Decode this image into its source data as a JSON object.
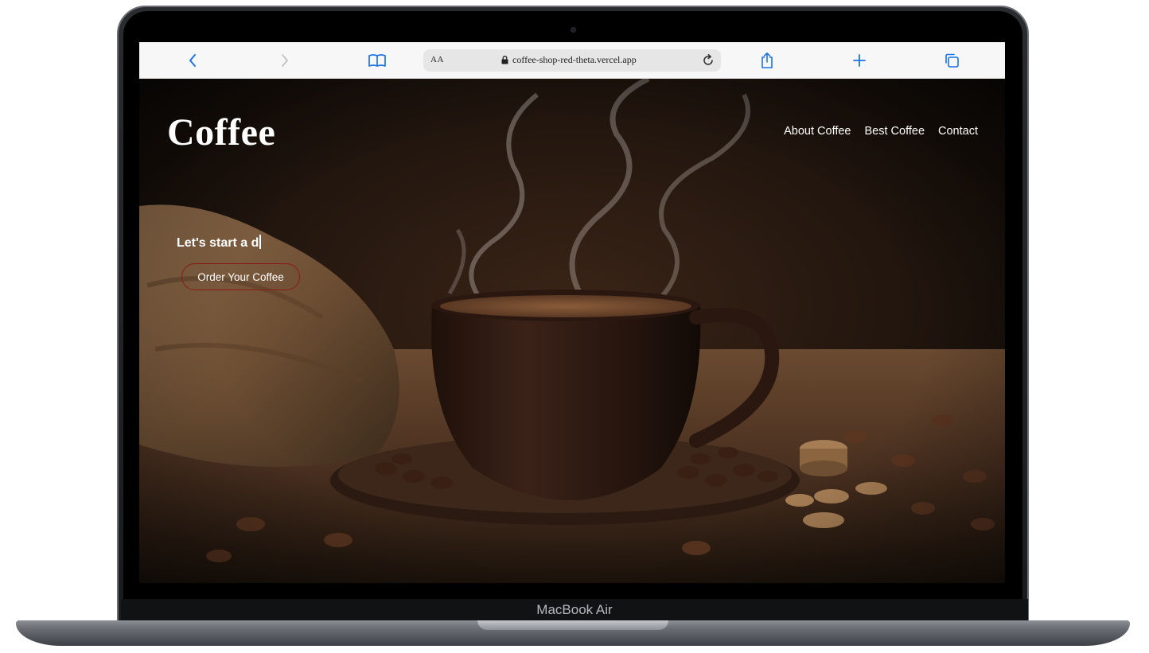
{
  "device": {
    "model_label": "MacBook Air"
  },
  "browser": {
    "address": {
      "text_size_label": "AA",
      "url": "coffee-shop-red-theta.vercel.app"
    },
    "icons": {
      "back": "chevron-left-icon",
      "forward": "chevron-right-icon",
      "bookmarks": "book-icon",
      "lock": "lock-icon",
      "reload": "reload-icon",
      "share": "share-icon",
      "new_tab": "plus-icon",
      "tabs": "tabs-icon"
    },
    "accent_color": "#1a73e8"
  },
  "site": {
    "logo": "Coffee",
    "nav": [
      {
        "label": "About Coffee"
      },
      {
        "label": "Best Coffee"
      },
      {
        "label": "Contact"
      }
    ],
    "hero": {
      "tagline": "Let's start a d",
      "cta_label": "Order Your Coffee",
      "cta_border_color": "#8a1a12"
    }
  }
}
